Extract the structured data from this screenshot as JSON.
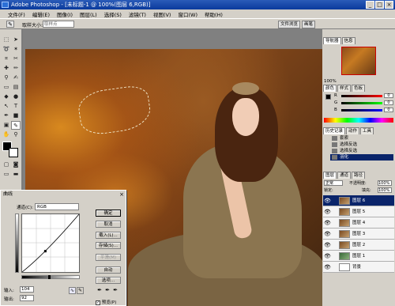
{
  "window": {
    "title": "Adobe Photoshop - [未标题-1 @ 100%(图层 6,RGB)]",
    "buttons": [
      "_",
      "□",
      "×"
    ]
  },
  "menu": [
    "文件(F)",
    "编辑(E)",
    "图像(I)",
    "图层(L)",
    "选择(S)",
    "滤镜(T)",
    "视图(V)",
    "窗口(W)",
    "帮助(H)"
  ],
  "options": {
    "label": "取样大小:",
    "sample_value": "取样点",
    "file_tabs": [
      "文件浏览",
      "画笔"
    ]
  },
  "panels": {
    "navigator_tabs": [
      "导航器",
      "信息"
    ],
    "navigator_zoom": "100%",
    "color_tabs": [
      "颜色",
      "样式",
      "色板"
    ],
    "rgb": [
      {
        "ch": "R",
        "val": "0"
      },
      {
        "ch": "G",
        "val": "0"
      },
      {
        "ch": "B",
        "val": "0"
      }
    ],
    "history_tabs": [
      "历史记录",
      "动作",
      "工具"
    ],
    "history": [
      "套索",
      "选择反选",
      "选择反选",
      "羽化"
    ],
    "layers_tabs": [
      "图层",
      "通道",
      "路径"
    ],
    "layer_blend": "正常",
    "layer_opacity_label": "不透明度:",
    "layer_opacity": "100%",
    "layer_lock_label": "锁定:",
    "layer_fill_label": "填充:",
    "layer_fill": "100%",
    "layers": [
      "图层 6",
      "图层 5",
      "图层 4",
      "图层 3",
      "图层 2",
      "图层 1",
      "背景"
    ]
  },
  "curves": {
    "title": "曲线",
    "channel_label": "通道(C):",
    "channel_value": "RGB",
    "buttons": [
      "确定",
      "取消",
      "载入(L)...",
      "存储(S)...",
      "平滑(M)",
      "自动",
      "选项..."
    ],
    "input_label": "输入:",
    "input_value": "104",
    "output_label": "输出:",
    "output_value": "92",
    "preview_label": "预览(P)",
    "point": {
      "input": 104,
      "output": 92
    }
  }
}
